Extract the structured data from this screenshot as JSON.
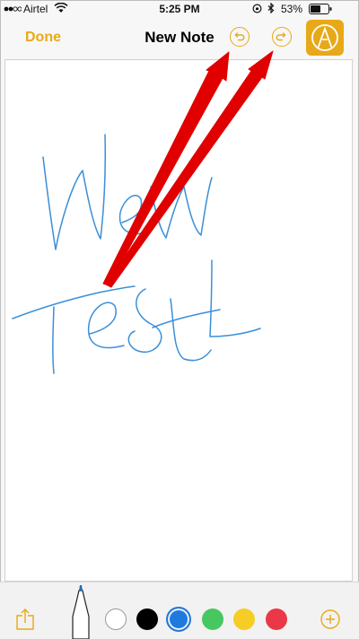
{
  "status_bar": {
    "carrier": "Airtel",
    "time": "5:25 PM",
    "battery": "53%"
  },
  "nav": {
    "done_label": "Done",
    "title": "New Note"
  },
  "colors": {
    "accent": "#e8a919",
    "ink": "#3a8fd9",
    "arrow": "#e00000"
  },
  "toolbar": {
    "active_tool": "pen",
    "selected_color": "blue",
    "swatches": [
      {
        "name": "white",
        "hex": "#ffffff"
      },
      {
        "name": "black",
        "hex": "#000000"
      },
      {
        "name": "blue",
        "hex": "#1f7ae0"
      },
      {
        "name": "green",
        "hex": "#47c760"
      },
      {
        "name": "yellow",
        "hex": "#f6cd24"
      },
      {
        "name": "red",
        "hex": "#eb3848"
      }
    ]
  }
}
